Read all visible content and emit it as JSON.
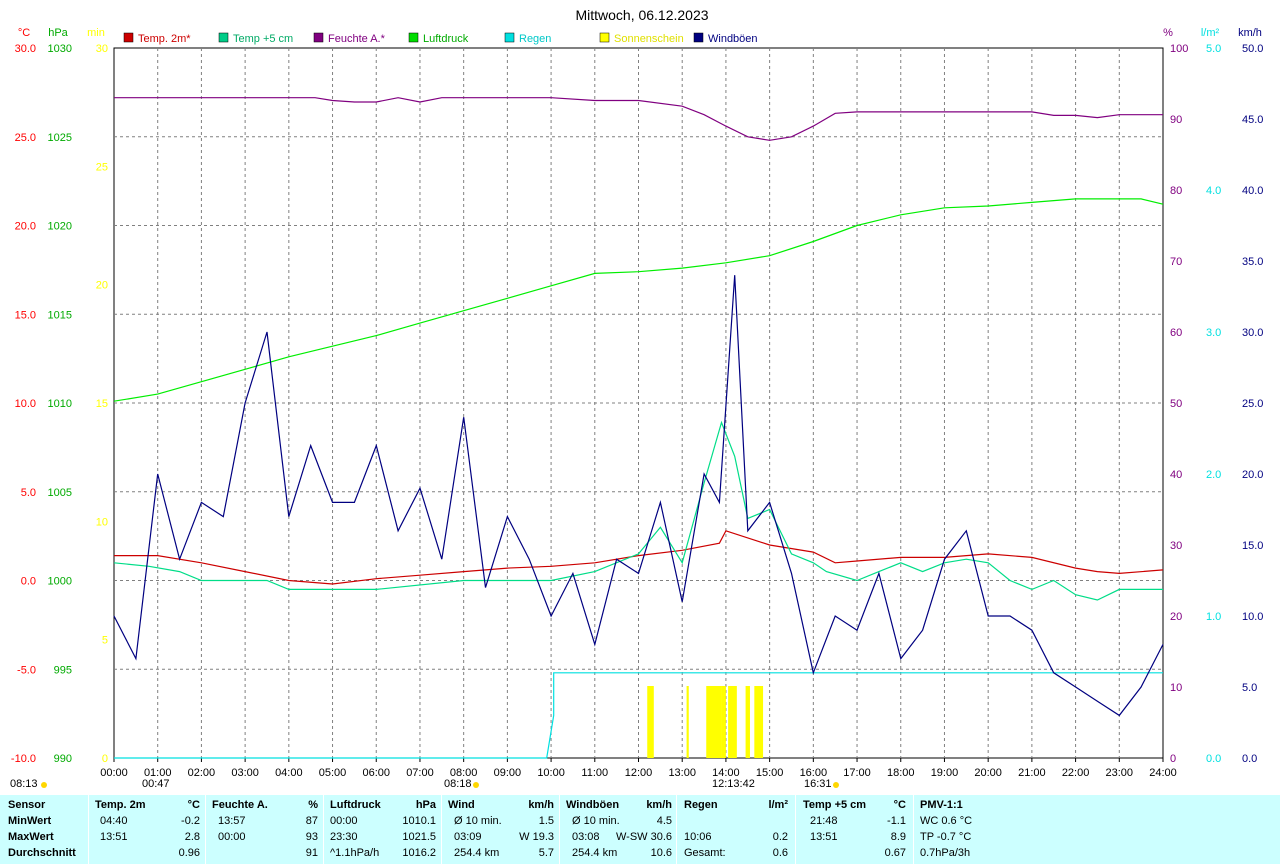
{
  "chart_data": {
    "type": "line",
    "title": "Mittwoch, 06.12.2023",
    "axes": {
      "temp": {
        "unit": "°C",
        "ticks": [
          "30.0",
          "25.0",
          "20.0",
          "15.0",
          "10.0",
          "5.0",
          "0.0",
          "-5.0",
          "-10.0"
        ],
        "range": [
          -10,
          30
        ],
        "color": "#ff0000"
      },
      "pressure": {
        "unit": "hPa",
        "ticks": [
          "1030",
          "1025",
          "1020",
          "1015",
          "1010",
          "1005",
          "1000",
          "995",
          "990"
        ],
        "range": [
          990,
          1030
        ],
        "color": "#00aa00"
      },
      "sunshine": {
        "unit": "min",
        "ticks": [
          "30",
          "25",
          "20",
          "15",
          "10",
          "5",
          "0"
        ],
        "range": [
          0,
          30
        ],
        "color": "#ffff00"
      },
      "humidity": {
        "unit": "%",
        "ticks": [
          "100",
          "90",
          "80",
          "70",
          "60",
          "50",
          "40",
          "30",
          "20",
          "10",
          "0"
        ],
        "range": [
          0,
          100
        ],
        "color": "#800080"
      },
      "rain": {
        "unit": "l/m²",
        "ticks": [
          "5.0",
          "4.0",
          "3.0",
          "2.0",
          "1.0",
          "0.0"
        ],
        "range": [
          0,
          5
        ],
        "color": "#00e0e0"
      },
      "wind": {
        "unit": "km/h",
        "ticks": [
          "50.0",
          "45.0",
          "40.0",
          "35.0",
          "30.0",
          "25.0",
          "20.0",
          "15.0",
          "10.0",
          "5.0",
          "0.0"
        ],
        "range": [
          0,
          50
        ],
        "color": "#000080"
      }
    },
    "x_ticks": [
      "00:00",
      "01:00",
      "02:00",
      "03:00",
      "04:00",
      "05:00",
      "06:00",
      "07:00",
      "08:00",
      "09:00",
      "10:00",
      "11:00",
      "12:00",
      "13:00",
      "14:00",
      "15:00",
      "16:00",
      "17:00",
      "18:00",
      "19:00",
      "20:00",
      "21:00",
      "22:00",
      "23:00",
      "24:00"
    ],
    "sun_labels": {
      "sunrise": "08:13",
      "noon": "12:13:42",
      "sunset": "16:31",
      "moonrise_a": "00:47",
      "noon_b": "08:18"
    },
    "legend": [
      {
        "label": "Temp. 2m*",
        "color": "#cc0000"
      },
      {
        "label": "Temp +5 cm",
        "color": "#00cc88"
      },
      {
        "label": "Feuchte A.*",
        "color": "#800080"
      },
      {
        "label": "Luftdruck",
        "color": "#00dd00"
      },
      {
        "label": "Regen",
        "color": "#00e0e0"
      },
      {
        "label": "Sonnenschein",
        "color": "#ffff00"
      },
      {
        "label": "Windböen",
        "color": "#000080"
      }
    ],
    "series": [
      {
        "name": "Temp. 2m*",
        "axis": "temp",
        "x": [
          0,
          1,
          2,
          3,
          4,
          5,
          6,
          7,
          8,
          9,
          10,
          11,
          12,
          13,
          13.85,
          14,
          15,
          16,
          16.5,
          17,
          18,
          19,
          20,
          21,
          22,
          22.5,
          23,
          24
        ],
        "values": [
          1.4,
          1.4,
          1.0,
          0.5,
          0.0,
          -0.2,
          0.1,
          0.3,
          0.5,
          0.7,
          0.8,
          1.0,
          1.4,
          1.7,
          2.1,
          2.8,
          2.0,
          1.6,
          1.0,
          1.1,
          1.3,
          1.3,
          1.5,
          1.3,
          0.7,
          0.5,
          0.4,
          0.6
        ]
      },
      {
        "name": "Temp +5 cm",
        "axis": "temp",
        "x": [
          0,
          0.8,
          1.5,
          2,
          2.5,
          3.5,
          4,
          6,
          8,
          10,
          11,
          12,
          12.5,
          13,
          13.5,
          13.9,
          14.2,
          14.5,
          15,
          15.5,
          16,
          16.3,
          17,
          17.5,
          18,
          18.5,
          19,
          19.5,
          20,
          20.5,
          21,
          21.5,
          22,
          22.5,
          23,
          24
        ],
        "values": [
          1.0,
          0.8,
          0.5,
          0.0,
          0.0,
          0.0,
          -0.5,
          -0.5,
          0.0,
          0.0,
          0.5,
          1.5,
          3.0,
          1.0,
          5.5,
          8.9,
          7.0,
          3.5,
          4.0,
          1.5,
          1.0,
          0.5,
          0.0,
          0.5,
          1.0,
          0.5,
          1.0,
          1.2,
          1.0,
          0.0,
          -0.5,
          0.0,
          -0.8,
          -1.1,
          -0.5,
          -0.5
        ]
      },
      {
        "name": "Feuchte A.*",
        "axis": "humidity",
        "x": [
          0,
          4.6,
          5.0,
          5.5,
          6.0,
          6.5,
          7.0,
          7.5,
          8.0,
          9.0,
          10.0,
          11.0,
          12.0,
          13.0,
          13.5,
          14.0,
          14.5,
          15.0,
          15.5,
          16.0,
          16.5,
          17.0,
          18.0,
          19.0,
          20.0,
          21.0,
          21.5,
          22.0,
          22.5,
          23.0,
          24.0
        ],
        "values": [
          93,
          93,
          92.6,
          92.4,
          92.4,
          93,
          92.4,
          93,
          93,
          93,
          93,
          92.6,
          92.6,
          91.8,
          90.6,
          89,
          87.5,
          87.0,
          87.5,
          89,
          90.8,
          91,
          91,
          91,
          91,
          91,
          90.5,
          90.5,
          90.2,
          90.6,
          90.6
        ]
      },
      {
        "name": "Luftdruck",
        "axis": "pressure",
        "x": [
          0,
          1,
          2,
          3,
          4,
          5,
          6,
          7,
          8,
          9,
          10,
          11,
          12,
          13,
          14,
          15,
          16,
          17,
          18,
          19,
          20,
          21,
          22,
          23,
          23.5,
          24
        ],
        "values": [
          1010.1,
          1010.5,
          1011.2,
          1011.9,
          1012.6,
          1013.2,
          1013.8,
          1014.5,
          1015.2,
          1015.9,
          1016.6,
          1017.3,
          1017.4,
          1017.6,
          1017.9,
          1018.3,
          1019.1,
          1020.0,
          1020.6,
          1021.0,
          1021.1,
          1021.3,
          1021.5,
          1021.5,
          1021.5,
          1021.2
        ]
      },
      {
        "name": "Regen",
        "axis": "rain",
        "x": [
          0,
          9.9,
          10.06,
          10.06,
          10.5,
          24
        ],
        "values": [
          0,
          0,
          0.3,
          0.6,
          0.6,
          0.6
        ]
      },
      {
        "name": "Windböen",
        "axis": "wind",
        "x": [
          0,
          0.5,
          1.0,
          1.5,
          2.0,
          2.5,
          3.0,
          3.5,
          4.0,
          4.5,
          5.0,
          5.5,
          6.0,
          6.5,
          7.0,
          7.5,
          8.0,
          8.5,
          9.0,
          9.5,
          10.0,
          10.5,
          11.0,
          11.5,
          12.0,
          12.5,
          13.0,
          13.5,
          13.85,
          14.2,
          14.5,
          15.0,
          15.5,
          16.0,
          16.5,
          17.0,
          17.5,
          18.0,
          18.5,
          19.0,
          19.5,
          20.0,
          20.5,
          21.0,
          21.5,
          22.0,
          22.5,
          23.0,
          23.5,
          24.0
        ],
        "values": [
          10,
          7,
          20,
          14,
          18,
          17,
          25,
          30,
          17,
          22,
          18,
          18,
          22,
          16,
          19,
          14,
          24,
          12,
          17,
          14,
          10,
          13,
          8,
          14,
          13,
          18,
          11,
          20,
          18,
          34,
          16,
          18,
          13,
          6,
          10,
          9,
          13,
          7,
          9,
          14,
          16,
          10,
          10,
          9,
          6,
          5,
          4,
          3,
          5,
          8
        ]
      }
    ]
  },
  "sunshine_bars": [
    [
      12.2,
      12.35
    ],
    [
      13.1,
      13.15
    ],
    [
      13.55,
      13.9
    ],
    [
      13.9,
      14.0
    ],
    [
      14.05,
      14.25
    ],
    [
      14.45,
      14.55
    ],
    [
      14.65,
      14.85
    ]
  ],
  "stats": {
    "header": [
      "Sensor",
      "Temp. 2m",
      "°C",
      "Feuchte A.",
      "%",
      "Luftdruck",
      "hPa",
      "Wind",
      "km/h",
      "Windböen",
      "km/h",
      "Regen",
      "l/m²",
      "Temp +5 cm",
      "°C",
      "PMV-1:1"
    ],
    "rows": [
      {
        "label": "MinWert",
        "t_time": "04:40",
        "t_val": "-0.2",
        "h_time": "13:57",
        "h_val": "87",
        "p_time": "00:00",
        "p_val": "1010.1",
        "w_label": "Ø 10 min.",
        "w_val": "1.5",
        "g_label": "Ø 10 min.",
        "g_val": "4.5",
        "r_label": "",
        "r_val": "",
        "t5_time": "21:48",
        "t5_val": "-1.1",
        "pmv": "WC 0.6 °C"
      },
      {
        "label": "MaxWert",
        "t_time": "13:51",
        "t_val": "2.8",
        "h_time": "00:00",
        "h_val": "93",
        "p_time": "23:30",
        "p_val": "1021.5",
        "w_label": "03:09",
        "w_val": "W 19.3",
        "g_label": "03:08",
        "g_val": "W-SW 30.6",
        "r_label": "10:06",
        "r_val": "0.2",
        "t5_time": "13:51",
        "t5_val": "8.9",
        "pmv": "TP -0.7 °C"
      },
      {
        "label": "Durchschnitt",
        "t_time": "",
        "t_val": "0.96",
        "h_time": "",
        "h_val": "91",
        "p_time": "^1.1hPa/h",
        "p_val": "1016.2",
        "w_label": "254.4 km",
        "w_val": "5.7",
        "g_label": "254.4 km",
        "g_val": "10.6",
        "r_label": "Gesamt:",
        "r_val": "0.6",
        "t5_time": "",
        "t5_val": "0.67",
        "pmv": "0.7hPa/3h"
      }
    ]
  }
}
